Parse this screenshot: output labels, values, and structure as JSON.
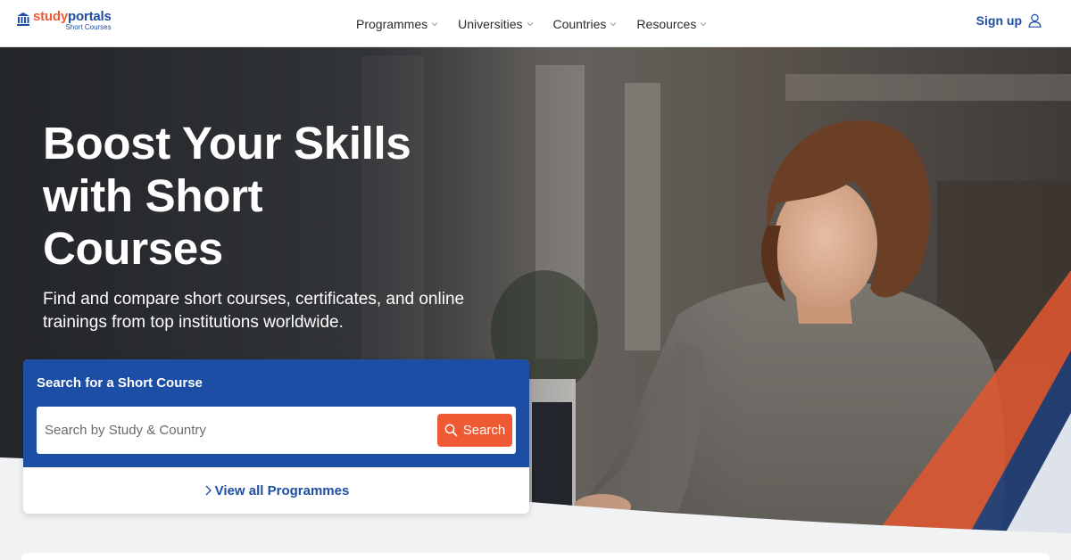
{
  "header": {
    "logo": {
      "study": "study",
      "portals": "portals",
      "sub": "Short Courses"
    },
    "nav": [
      {
        "label": "Programmes"
      },
      {
        "label": "Universities"
      },
      {
        "label": "Countries"
      },
      {
        "label": "Resources"
      }
    ],
    "signup_label": "Sign up"
  },
  "hero": {
    "title_line1": "Boost Your Skills",
    "title_line2": "with Short",
    "title_line3": "Courses",
    "subtitle_line1": "Find and compare short courses, certificates, and online",
    "subtitle_line2": "trainings from top institutions worldwide."
  },
  "search": {
    "heading": "Search for a Short Course",
    "placeholder": "Search by Study & Country",
    "button_label": "Search",
    "view_all_label": "View all Programmes"
  },
  "colors": {
    "brand_blue": "#1c4ea6",
    "accent_orange": "#ef5a35"
  }
}
